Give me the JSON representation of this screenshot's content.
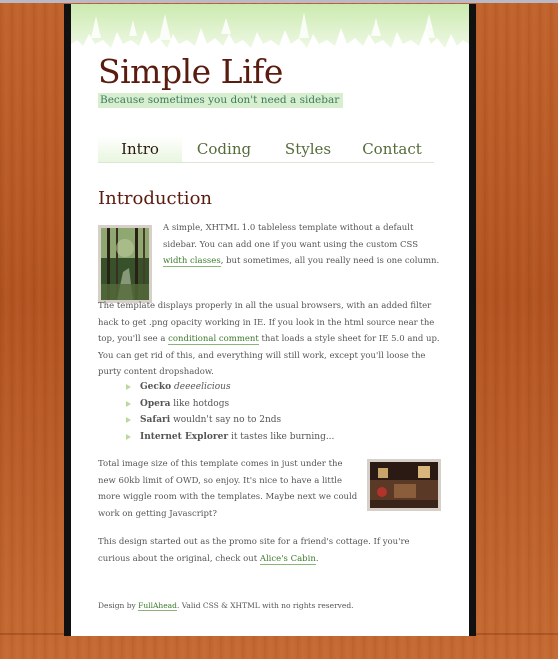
{
  "site": {
    "title": "Simple Life",
    "tagline": "Because sometimes you don't need a sidebar"
  },
  "nav": {
    "items": [
      {
        "label": "Intro",
        "active": true
      },
      {
        "label": "Coding",
        "active": false
      },
      {
        "label": "Styles",
        "active": false
      },
      {
        "label": "Contact",
        "active": false
      }
    ]
  },
  "content": {
    "heading": "Introduction",
    "p1": {
      "before_link": "A simple, XHTML 1.0 tableless template without a default sidebar. You can add one if you want using the custom CSS ",
      "link": "width classes",
      "after_link": ", but sometimes, all you really need is one column."
    },
    "p2": {
      "before_link": "The template displays properly in all the usual browsers, with an added filter hack to get .png opacity working in IE. If you look in the html source near the top, you'll see a ",
      "link": "conditional comment",
      "after_link": " that loads a style sheet for IE 5.0 and up. You can get rid of this, and everything will still work, except you'll loose the purty content dropshadow."
    },
    "list": [
      {
        "bold": "Gecko",
        "italic": "deeeelicious",
        "rest": ""
      },
      {
        "bold": "Opera",
        "italic": "",
        "rest": " like hotdogs"
      },
      {
        "bold": "Safari",
        "italic": "",
        "rest": " wouldn't say no to 2nds"
      },
      {
        "bold": "Internet Explorer",
        "italic": "",
        "rest": " it tastes like burning..."
      }
    ],
    "p3": "Total image size of this template comes in just under the new 60kb limit of OWD, so enjoy. It's nice to have a little more wiggle room with the templates. Maybe next we could work on getting Javascript?",
    "p4": {
      "before_link": "This design started out as the promo site for a friend's cottage. If you're curious about the original, check out ",
      "link": "Alice's Cabin",
      "after_link": "."
    }
  },
  "footer": {
    "before_link": "Design by ",
    "link": "FullAhead",
    "after_link": ". Valid CSS & XHTML with no rights reserved."
  },
  "colors": {
    "wood": "#b5561f",
    "title": "#5a1c0e",
    "link": "#3b7a2a",
    "tagline_bg": "#d7efcf"
  }
}
